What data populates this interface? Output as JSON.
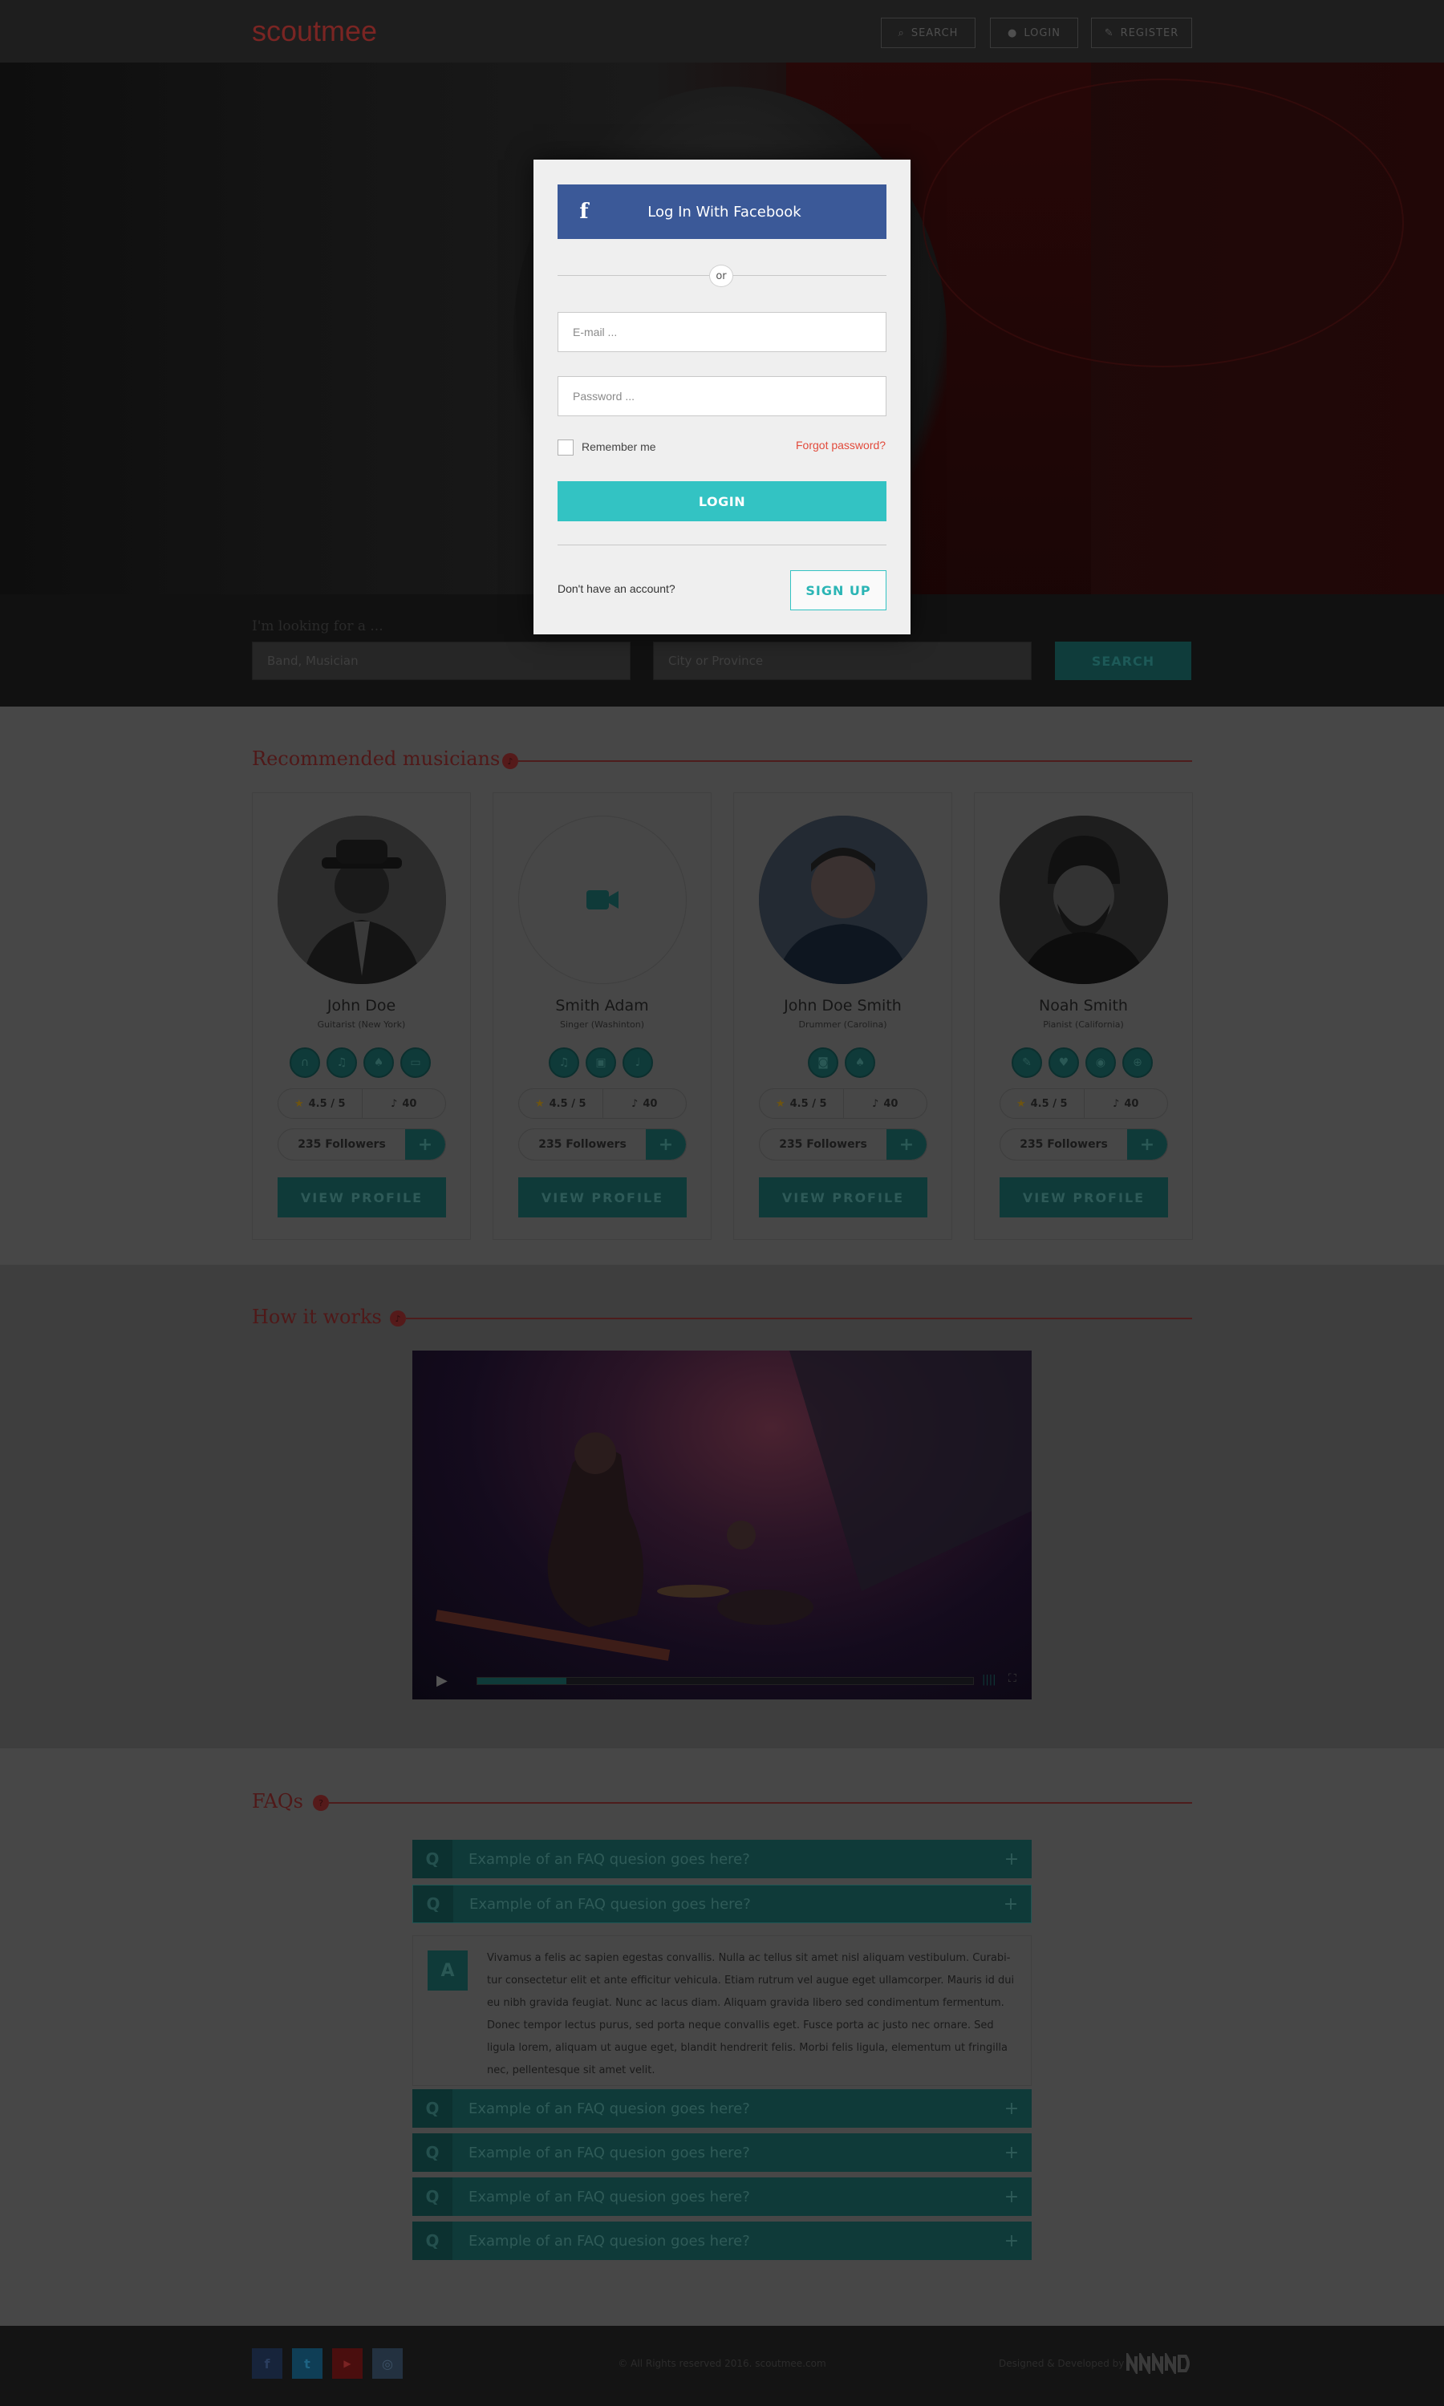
{
  "header": {
    "logo": "scoutmee",
    "nav": [
      {
        "label": "SEARCH",
        "icon": "search-icon"
      },
      {
        "label": "LOGIN",
        "icon": "user-icon"
      },
      {
        "label": "REGISTER",
        "icon": "pencil-icon"
      }
    ]
  },
  "search": {
    "label": "I'm looking for a ...",
    "field1_placeholder": "Band, Musician",
    "field2_placeholder": "City or Province",
    "button": "SEARCH"
  },
  "recommended": {
    "title": "Recommended musicians",
    "musicians": [
      {
        "name": "John Doe",
        "role": "Guitarist (New York)",
        "rating": "4.5 / 5",
        "tracks": "40",
        "followers": "235 Followers",
        "button": "VIEW PROFILE",
        "icons": [
          "headphones-icon",
          "music-note-icon",
          "guitar-icon",
          "keyboard-icon"
        ]
      },
      {
        "name": "Smith Adam",
        "role": "Singer (Washinton)",
        "rating": "4.5 / 5",
        "tracks": "40",
        "followers": "235 Followers",
        "button": "VIEW PROFILE",
        "icons": [
          "music-note-icon",
          "speaker-icon",
          "microphone-icon"
        ]
      },
      {
        "name": "John Doe Smith",
        "role": "Drummer (Carolina)",
        "rating": "4.5 / 5",
        "tracks": "40",
        "followers": "235 Followers",
        "button": "VIEW PROFILE",
        "icons": [
          "camera-icon",
          "guitar-icon"
        ]
      },
      {
        "name": "Noah Smith",
        "role": "Pianist (California)",
        "rating": "4.5 / 5",
        "tracks": "40",
        "followers": "235 Followers",
        "button": "VIEW PROFILE",
        "icons": [
          "pencil-icon",
          "heart-icon",
          "record-icon",
          "lifebuoy-icon"
        ]
      }
    ]
  },
  "how": {
    "title": "How it works"
  },
  "faq": {
    "title": "FAQs",
    "q_letter": "Q",
    "a_letter": "A",
    "items": [
      "Example of an FAQ quesion goes here?",
      "Example of an FAQ quesion goes here?",
      "Example of an FAQ quesion goes here?",
      "Example of an FAQ quesion goes here?",
      "Example of an FAQ quesion goes here?",
      "Example of an FAQ quesion goes here?"
    ],
    "answer": "Vivamus a felis ac sapien egestas convallis. Nulla ac tellus sit amet nisl aliquam vestibulum. Curabi-tur consectetur elit et ante efficitur vehicula. Etiam rutrum vel augue eget ullamcorper. Mauris id dui eu nibh gravida feugiat. Nunc ac lacus diam. Aliquam gravida libero sed condimentum fermentum. Donec tempor lectus purus, sed porta neque convallis eget. Fusce porta ac justo nec ornare. Sed ligula lorem, aliquam ut augue eget, blandit hendrerit felis. Morbi felis ligula, elementum ut fringilla nec, pellentesque sit amet velit."
  },
  "footer": {
    "copyright": "© All Rights reserved 2016. scoutmee.com",
    "credit": "Designed & Developed by",
    "social": [
      "f",
      "t",
      "▶",
      "◎"
    ]
  },
  "login_modal": {
    "facebook_label": "Log In With Facebook",
    "or": "or",
    "email_placeholder": "E-mail ...",
    "password_placeholder": "Password ...",
    "remember": "Remember me",
    "forgot": "Forgot password?",
    "login_button": "LOGIN",
    "no_account": "Don't have an account?",
    "signup_button": "SIGN UP"
  },
  "colors": {
    "teal": "#33c3c3",
    "facebook": "#3b5998",
    "brand_red": "#e24a3b"
  }
}
